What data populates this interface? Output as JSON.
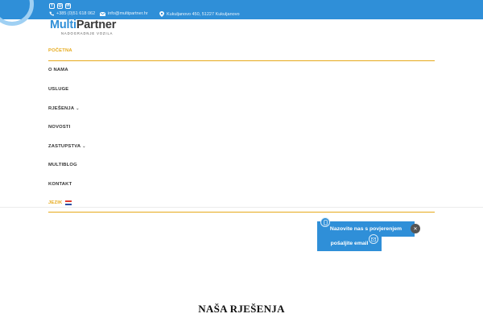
{
  "topbar": {
    "social_icons": [
      "facebook-icon",
      "instagram-icon",
      "linkedin-icon"
    ],
    "phone": "+385 (0)51 618 062",
    "email": "info@multipartner.hr",
    "address": "Kukuljanovo 450, 51227 Kukuljanovo"
  },
  "logo": {
    "part1": "Multi",
    "part2": "Partner",
    "tagline": "NADOGRADNJE VOZILA"
  },
  "nav": {
    "items": [
      {
        "label": "POČETNA"
      },
      {
        "label": "O NAMA"
      },
      {
        "label": "USLUGE"
      },
      {
        "label": "RJEŠENJA"
      },
      {
        "label": "NOVOSTI"
      },
      {
        "label": "ZASTUPSTVA"
      },
      {
        "label": "MULTIBLOG"
      },
      {
        "label": "KONTAKT"
      },
      {
        "label": "JEZIK"
      }
    ]
  },
  "cta": {
    "call_label": "Nazovite nas s povjerenjem",
    "email_label": "pošaljite email"
  },
  "section": {
    "title": "NAŠA RJEŠENJA"
  },
  "colors": {
    "brand_blue": "#2f8fd8",
    "accent_gold": "#e6a91a"
  }
}
